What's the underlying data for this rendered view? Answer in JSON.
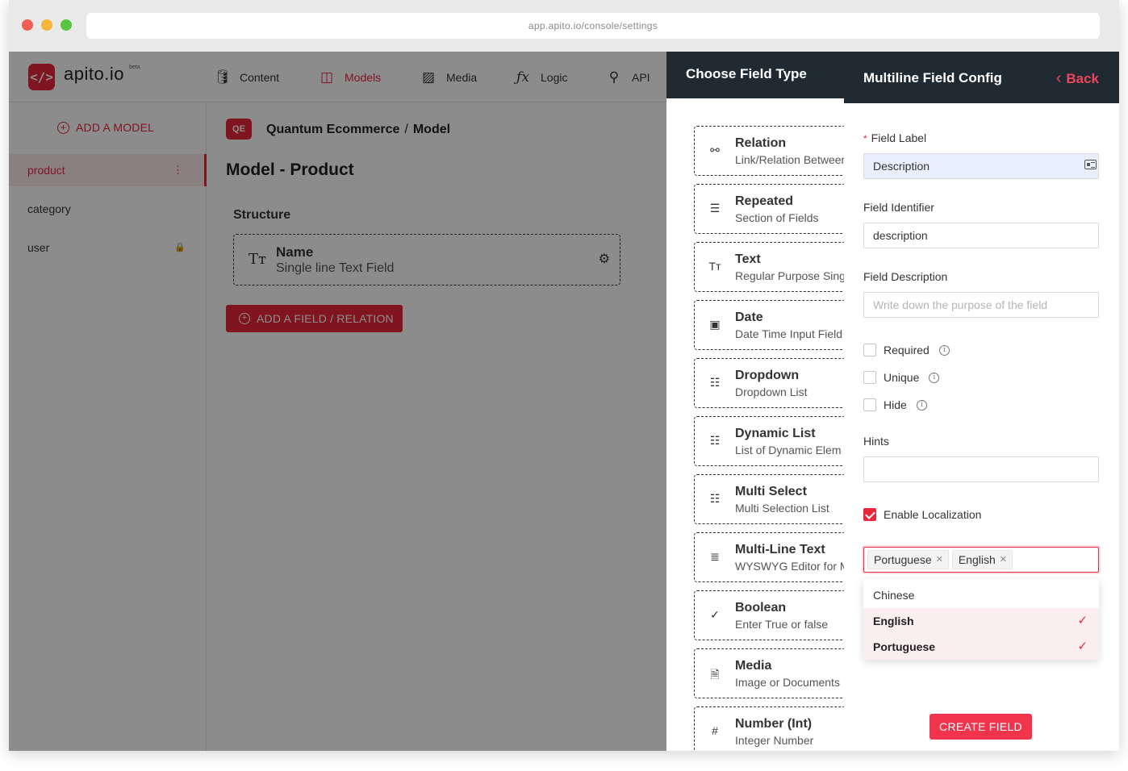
{
  "browser": {
    "url": "app.apito.io/console/settings",
    "dot_colors": [
      "#ee5e55",
      "#f4b73c",
      "#5ac53f"
    ]
  },
  "brand": {
    "logo_glyph": "</>",
    "name": "apito.io",
    "badge": "beta",
    "accent_color": "#e9273a",
    "header_dark": "#1f2a33"
  },
  "topnav": {
    "items": [
      {
        "label": "Content",
        "icon": "database-icon"
      },
      {
        "label": "Models",
        "icon": "book-icon",
        "active": true
      },
      {
        "label": "Media",
        "icon": "image-icon"
      },
      {
        "label": "Logic",
        "icon": "function-icon"
      },
      {
        "label": "API",
        "icon": "plug-icon"
      }
    ]
  },
  "sidebar": {
    "add_label": "ADD A MODEL",
    "items": [
      {
        "label": "product",
        "active": true,
        "trail": "⋮",
        "trail_icon": "more-vertical-icon"
      },
      {
        "label": "category",
        "trail": ""
      },
      {
        "label": "user",
        "trail": "🔒",
        "trail_icon": "lock-icon"
      }
    ]
  },
  "main": {
    "project_badge": "QE",
    "breadcrumb": {
      "project": "Quantum Ecommerce",
      "separator": "/",
      "section": "Model"
    },
    "title": "Model - Product",
    "structure_label": "Structure",
    "fields": [
      {
        "icon_glyph": "Tт",
        "name": "Name",
        "description": "Single line Text Field"
      }
    ],
    "add_field_label": "ADD A FIELD / RELATION"
  },
  "chooser": {
    "title": "Choose Field Type",
    "types": [
      {
        "name": "Relation",
        "desc": "Link/Relation Between",
        "icon": "relation-icon",
        "glyph": "⚯"
      },
      {
        "name": "Repeated",
        "desc": "Section of Fields",
        "icon": "repeated-icon",
        "glyph": "☰"
      },
      {
        "name": "Text",
        "desc": "Regular Purpose Single",
        "icon": "text-icon",
        "glyph": "Tт"
      },
      {
        "name": "Date",
        "desc": "Date Time Input Field",
        "icon": "calendar-icon",
        "glyph": "▣"
      },
      {
        "name": "Dropdown",
        "desc": "Dropdown List",
        "icon": "list-icon",
        "glyph": "☷"
      },
      {
        "name": "Dynamic List",
        "desc": "List of Dynamic Elem",
        "icon": "list-icon",
        "glyph": "☷"
      },
      {
        "name": "Multi Select",
        "desc": "Multi Selection List",
        "icon": "list-icon",
        "glyph": "☷"
      },
      {
        "name": "Multi-Line Text",
        "desc": "WYSWYG Editor for M",
        "icon": "align-center-icon",
        "glyph": "≣"
      },
      {
        "name": "Boolean",
        "desc": "Enter True or false",
        "icon": "check-circle-icon",
        "glyph": "✓"
      },
      {
        "name": "Media",
        "desc": "Image or Documents",
        "icon": "file-icon",
        "glyph": "🗎"
      },
      {
        "name": "Number (Int)",
        "desc": "Integer Number",
        "icon": "hash-icon",
        "glyph": "#"
      }
    ]
  },
  "config": {
    "title": "Multiline Field Config",
    "back_label": "Back",
    "field_label": {
      "label": "Field Label",
      "required_mark": "*",
      "value": "Description"
    },
    "field_identifier": {
      "label": "Field Identifier",
      "value": "description"
    },
    "field_description": {
      "label": "Field Description",
      "value": "",
      "placeholder": "Write down the purpose of the field"
    },
    "checks": [
      {
        "label": "Required",
        "checked": false
      },
      {
        "label": "Unique",
        "checked": false
      },
      {
        "label": "Hide",
        "checked": false
      }
    ],
    "hints": {
      "label": "Hints",
      "value": ""
    },
    "localization": {
      "label": "Enable Localization",
      "checked": true
    },
    "selected_languages": [
      "Portuguese",
      "English"
    ],
    "language_options": [
      {
        "label": "Chinese",
        "selected": false
      },
      {
        "label": "English",
        "selected": true
      },
      {
        "label": "Portuguese",
        "selected": true
      }
    ],
    "create_label": "CREATE FIELD"
  }
}
